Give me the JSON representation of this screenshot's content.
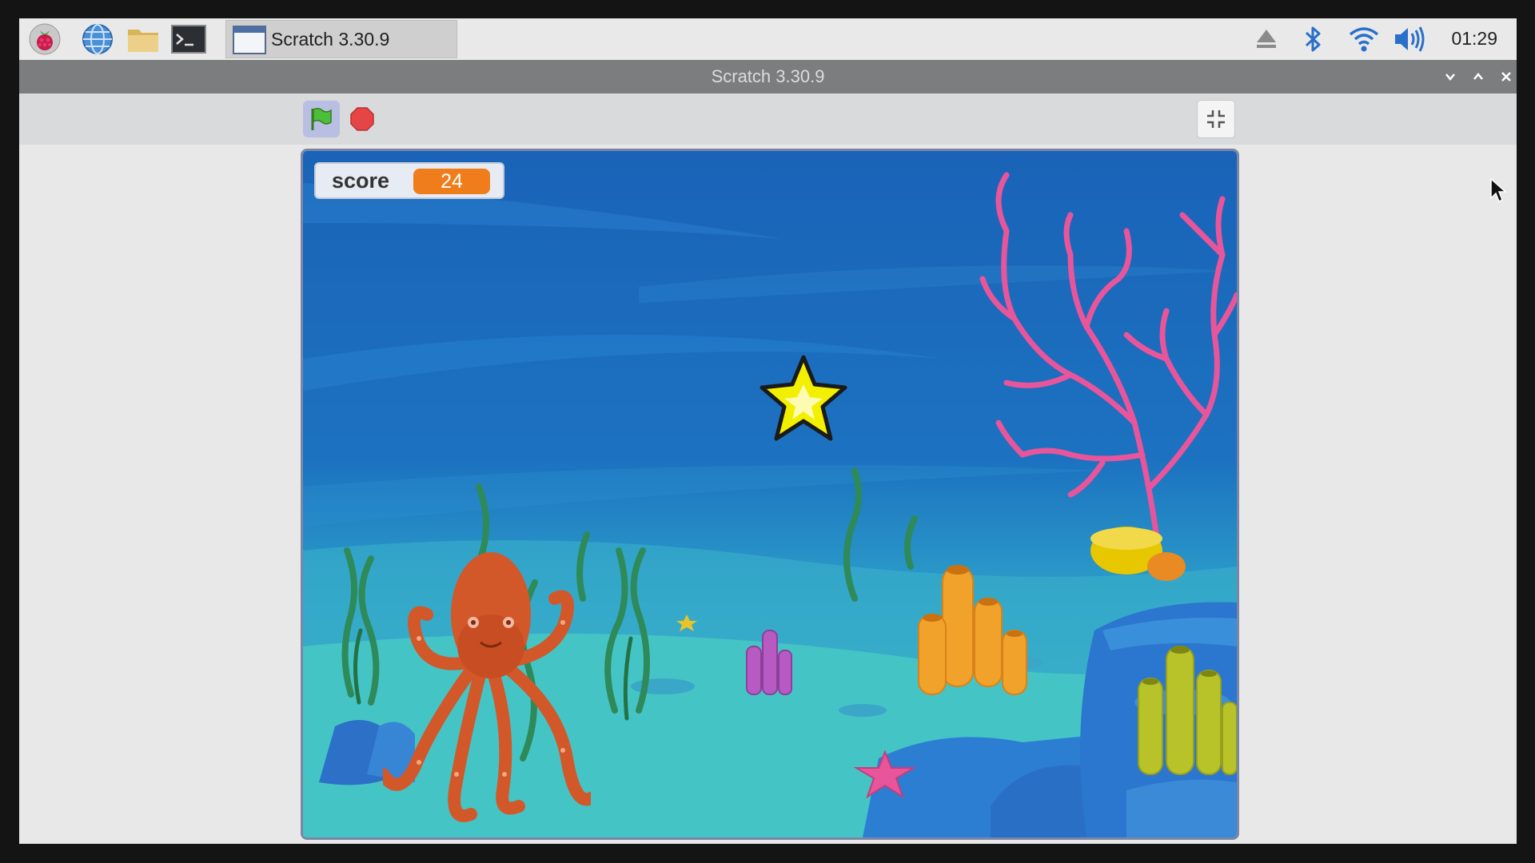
{
  "taskbar": {
    "task_label": "Scratch 3.30.9",
    "clock": "01:29",
    "icons": [
      "raspberry-menu-icon",
      "web-browser-icon",
      "file-manager-icon",
      "terminal-icon",
      "eject-icon",
      "bluetooth-icon",
      "wifi-icon",
      "volume-icon"
    ]
  },
  "window": {
    "title": "Scratch 3.30.9",
    "controls": [
      "minimize-icon",
      "maximize-icon",
      "close-icon"
    ]
  },
  "toolbar": {
    "icons": [
      "green-flag-icon",
      "stop-icon",
      "exit-fullscreen-icon"
    ]
  },
  "stage": {
    "score_label": "score",
    "score_value": "24",
    "sprites": [
      "star",
      "octopus",
      "starfish",
      "coral",
      "seaweed"
    ]
  },
  "colors": {
    "water_top": "#1a63b8",
    "water_bottom": "#3ec3c7",
    "score_badge": "#f07d1b",
    "coral_pink": "#e8559a",
    "octopus": "#d2582a"
  }
}
